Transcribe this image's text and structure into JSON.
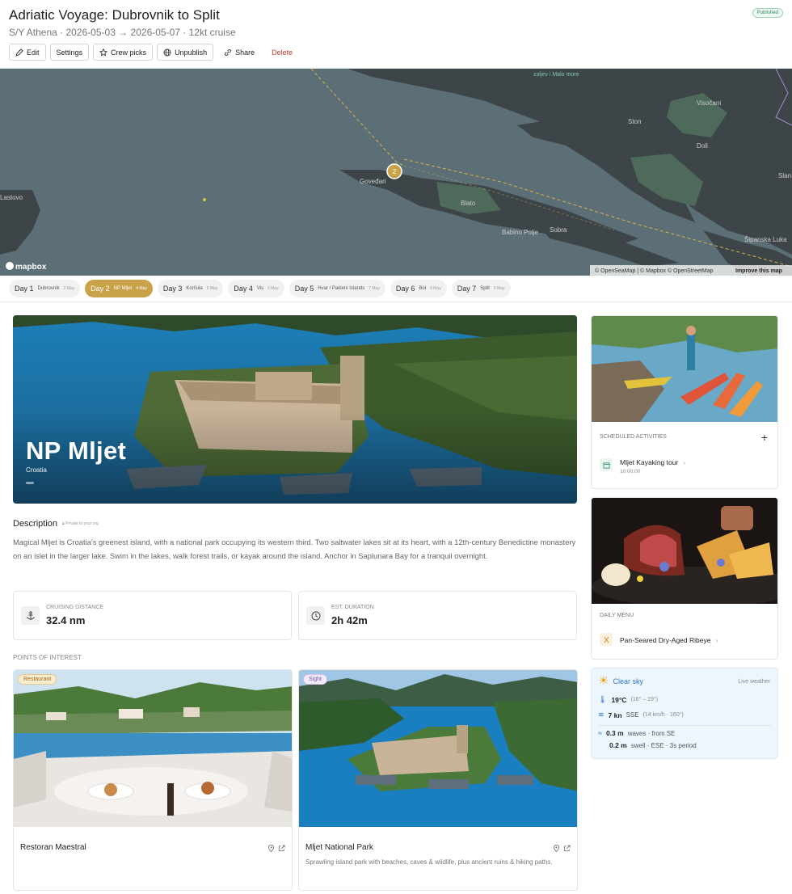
{
  "header": {
    "title": "Adriatic Voyage: Dubrovnik to Split",
    "subtitle": "S/Y Athena · 2026-05-03 → 2026-05-07 · 12kt cruise",
    "status": "Published",
    "actions": {
      "edit": "Edit",
      "settings": "Settings",
      "crew_picks": "Crew picks",
      "unpublish": "Unpublish",
      "share": "Share",
      "delete": "Delete"
    }
  },
  "map": {
    "labels": [
      "zaljev i Malo more",
      "Visočani",
      "Ston",
      "Doli",
      "Goveđari",
      "Blato",
      "Babino Polje",
      "Sobra",
      "Šipanska Luka",
      "Lastovo",
      "Slan"
    ],
    "marker": "2",
    "logo": "mapbox",
    "attribution": "© OpenSeaMap | © Mapbox © OpenStreetMap",
    "improve": "Improve this map"
  },
  "days": [
    {
      "label": "Day 1",
      "loc": "Dubrovnik",
      "date": "3 May",
      "active": false
    },
    {
      "label": "Day 2",
      "loc": "NP Mljet",
      "date": "4 May",
      "active": true
    },
    {
      "label": "Day 3",
      "loc": "Korčula",
      "date": "5 May",
      "active": false
    },
    {
      "label": "Day 4",
      "loc": "Vis",
      "date": "6 May",
      "active": false
    },
    {
      "label": "Day 5",
      "loc": "Hvar / Pakleni Islands",
      "date": "7 May",
      "active": false
    },
    {
      "label": "Day 6",
      "loc": "Bol",
      "date": "8 May",
      "active": false
    },
    {
      "label": "Day 7",
      "loc": "Split",
      "date": "9 May",
      "active": false
    }
  ],
  "hero": {
    "title": "NP Mljet",
    "country": "Croatia"
  },
  "description": {
    "heading": "Description",
    "privacy": "Private to your org",
    "text": "Magical Mljet is Croatia's greenest island, with a national park occupying its western third. Two saltwater lakes sit at its heart, with a 12th-century Benedictine monastery on an islet in the larger lake. Swim in the lakes, walk forest trails, or kayak around the island. Anchor in Saplunara Bay for a tranquil overnight."
  },
  "stats": {
    "distance_label": "Cruising distance",
    "distance_value": "32.4 nm",
    "duration_label": "Est. duration",
    "duration_value": "2h 42m"
  },
  "poi": {
    "heading": "POINTS OF INTEREST",
    "items": [
      {
        "tag": "Restaurant",
        "name": "Restoran Maestral",
        "text": ""
      },
      {
        "tag": "Sight",
        "name": "Mljet National Park",
        "text": "Sprawling island park with beaches, caves & wildlife, plus ancient ruins & hiking paths."
      }
    ]
  },
  "activities": {
    "heading": "Scheduled activities",
    "item_name": "Mljet Kayaking tour",
    "item_time": "10:00:00"
  },
  "menu": {
    "heading": "Daily menu",
    "item_name": "Pan-Seared Dry-Aged Ribeye"
  },
  "weather": {
    "condition": "Clear sky",
    "source": "Live weather",
    "temp": "19°C",
    "temp_range": "(16° – 19°)",
    "wind": "7 kn",
    "wind_dir": "SSE",
    "wind_detail": "(14 km/h · 160°)",
    "waves": "0.3 m",
    "waves_detail": "waves · from SE",
    "swell": "0.2 m",
    "swell_detail": "swell · ESE · 3s period"
  },
  "colors": {
    "accent": "#c9a24a",
    "danger": "#c0392b",
    "published": "#2f8a5a"
  }
}
